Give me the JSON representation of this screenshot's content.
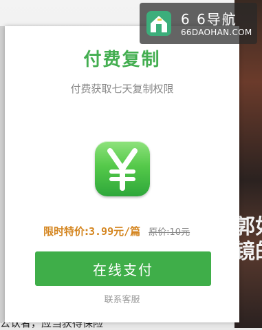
{
  "watermark": {
    "title": "6 6导航",
    "url": "66DAOHAN.COM"
  },
  "background": {
    "side_text": "郭如\n镜的",
    "bottom_text": "公认者，应当获得保险"
  },
  "modal": {
    "title": "付费复制",
    "subtitle": "付费获取七天复制权限",
    "icon": "yen-icon",
    "price_label": "限时特价:",
    "price_value": "3.99元/篇",
    "original_price": "原价:10元",
    "pay_button_label": "在线支付",
    "contact_link": "联系客服"
  },
  "colors": {
    "accent_green": "#3fae49",
    "title_green": "#43ae50",
    "price_orange": "#d4851f"
  }
}
